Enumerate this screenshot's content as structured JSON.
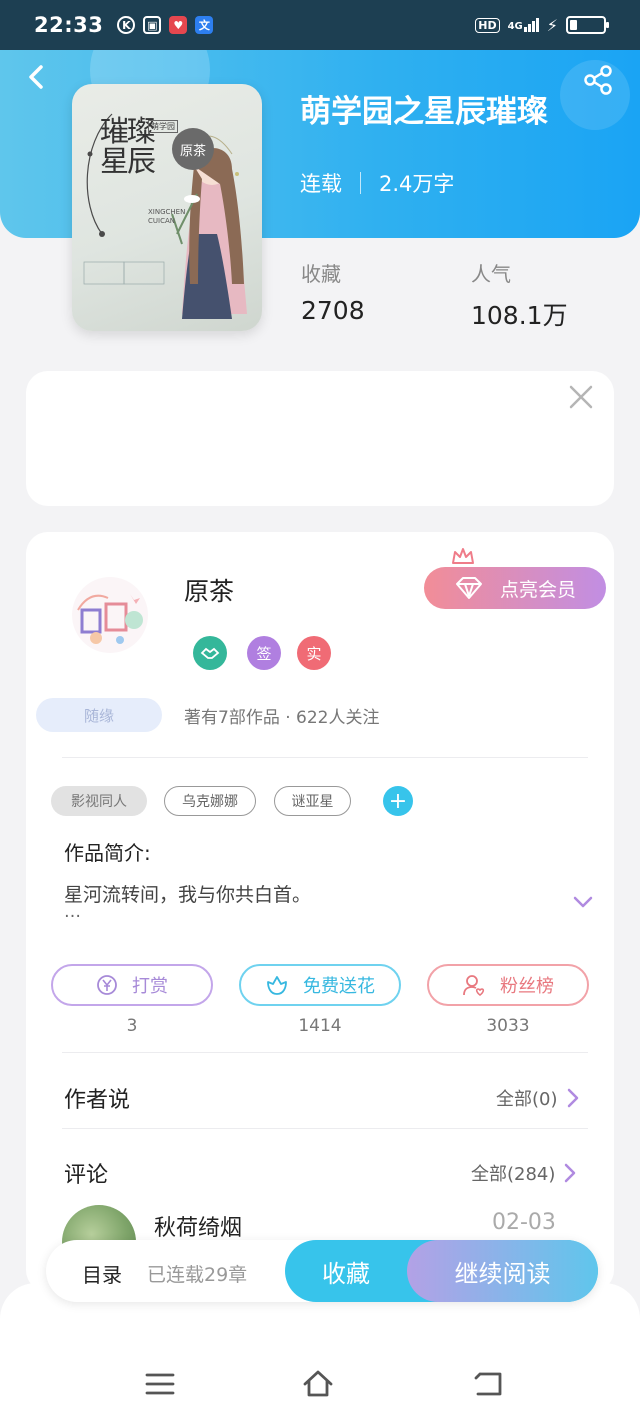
{
  "status_bar": {
    "time": "22:33",
    "app_icons": [
      "k-circle-icon",
      "dialog-icon",
      "heart-shield-icon",
      "translate-icon"
    ],
    "hd": "HD",
    "network": "4G"
  },
  "book": {
    "title": "萌学园之星辰璀璨",
    "status": "连载",
    "word_count": "2.4万字",
    "cover": {
      "title_chars": "璀璨星辰",
      "author_seal": "原茶",
      "pinyin": "XINGCHEN CUICAN",
      "tag": "萌学园"
    },
    "stats": [
      {
        "label": "收藏",
        "value": "2708"
      },
      {
        "label": "人气",
        "value": "108.1万"
      }
    ]
  },
  "author": {
    "name": "原茶",
    "vip_label": "点亮会员",
    "badges": [
      {
        "name": "handshake-badge-icon",
        "text": "",
        "color": "#34b79a"
      },
      {
        "name": "signed-badge",
        "text": "签",
        "color": "#b07fe0"
      },
      {
        "name": "verified-badge",
        "text": "实",
        "color": "#f06b75"
      }
    ],
    "fate_label": "随缘",
    "works_summary": "著有7部作品 · 622人关注"
  },
  "tags": [
    {
      "label": "影视同人",
      "style": "filled"
    },
    {
      "label": "乌克娜娜",
      "style": "outline"
    },
    {
      "label": "谜亚星",
      "style": "outline"
    }
  ],
  "intro": {
    "heading": "作品简介:",
    "text": "星河流转间，我与你共白首。",
    "more": "…"
  },
  "actions": [
    {
      "label": "打赏",
      "count": "3",
      "color": "#b08ae0",
      "icon": "yen-icon"
    },
    {
      "label": "免费送花",
      "count": "1414",
      "color": "#37c4eb",
      "icon": "flower-icon"
    },
    {
      "label": "粉丝榜",
      "count": "3033",
      "color": "#ee7f86",
      "icon": "fan-user-icon"
    }
  ],
  "author_says": {
    "title": "作者说",
    "all": "全部(0)"
  },
  "comments": {
    "title": "评论",
    "all": "全部(284)",
    "first": {
      "name": "秋荷绮烟",
      "date": "02-03"
    }
  },
  "bottom_bar": {
    "toc": "目录",
    "chapters": "已连载29章",
    "collect": "收藏",
    "read": "继续阅读"
  },
  "nav": [
    "menu-icon",
    "home-icon",
    "back-nav-icon"
  ]
}
